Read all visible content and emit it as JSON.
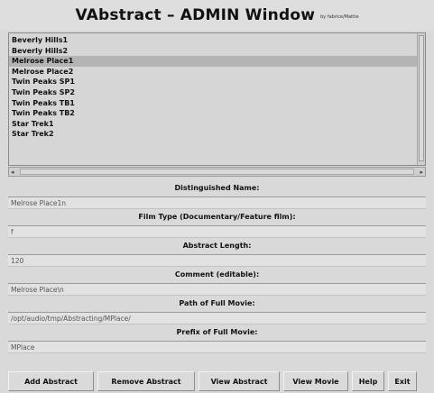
{
  "window": {
    "title": "VAbstract – ADMIN Window",
    "byline": "by fabrice/Mattie"
  },
  "list": {
    "items": [
      {
        "label": "Beverly Hills1",
        "selected": false
      },
      {
        "label": "Beverly Hills2",
        "selected": false
      },
      {
        "label": "Melrose Place1",
        "selected": true
      },
      {
        "label": "Melrose Place2",
        "selected": false
      },
      {
        "label": "Twin Peaks SP1",
        "selected": false
      },
      {
        "label": "Twin Peaks SP2",
        "selected": false
      },
      {
        "label": "Twin Peaks TB1",
        "selected": false
      },
      {
        "label": "Twin Peaks TB2",
        "selected": false
      },
      {
        "label": "Star Trek1",
        "selected": false
      },
      {
        "label": "Star Trek2",
        "selected": false
      }
    ]
  },
  "scroll": {
    "left_arrow": "◂",
    "right_arrow": "▸"
  },
  "fields": [
    {
      "label": "Distinguished Name:",
      "value": "Melrose Place1n"
    },
    {
      "label": "Film Type (Documentary/Feature film):",
      "value": "f"
    },
    {
      "label": "Abstract Length:",
      "value": "120"
    },
    {
      "label": "Comment (editable):",
      "value": "Melrose Place\\n"
    },
    {
      "label": "Path of Full Movie:",
      "value": "/opt/audio/tmp/Abstracting/MPlace/"
    },
    {
      "label": "Prefix of Full Movie:",
      "value": "MPlace"
    }
  ],
  "buttons": {
    "add": "Add Abstract",
    "remove": "Remove Abstract",
    "view_abstract": "View Abstract",
    "view_movie": "View Movie",
    "help": "Help",
    "exit": "Exit"
  }
}
